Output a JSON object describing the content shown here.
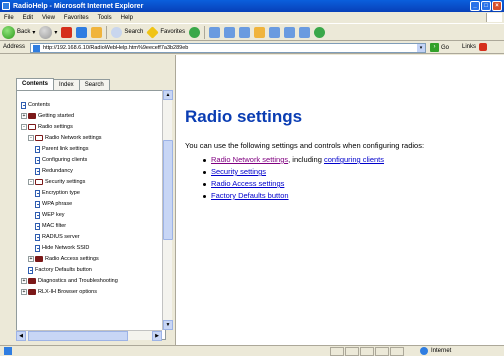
{
  "window": {
    "title": "RadioHelp - Microsoft Internet Explorer"
  },
  "menu": [
    "File",
    "Edit",
    "View",
    "Favorites",
    "Tools",
    "Help"
  ],
  "toolbar": {
    "back": "Back",
    "search": "Search",
    "favorites": "Favorites"
  },
  "address": {
    "label": "Address",
    "url": "http://192.168.6.10/RadioWebHelp.htm%9eeceff7a3b289eb",
    "go": "Go",
    "links": "Links"
  },
  "sidebar": {
    "tabs": [
      "Contents",
      "Index",
      "Search"
    ],
    "tree": [
      {
        "label": "Contents",
        "icon": "doc"
      },
      {
        "label": "Getting started",
        "icon": "book",
        "expander": "+"
      },
      {
        "label": "Radio settings",
        "icon": "book-open",
        "expander": "-"
      },
      {
        "label": "Radio Network settings",
        "icon": "book-open",
        "expander": "-"
      },
      {
        "label": "Parent link settings",
        "icon": "doc"
      },
      {
        "label": "Configuring clients",
        "icon": "doc"
      },
      {
        "label": "Redundancy",
        "icon": "doc"
      },
      {
        "label": "Security settings",
        "icon": "book-open",
        "expander": "-"
      },
      {
        "label": "Encryption type",
        "icon": "doc"
      },
      {
        "label": "WPA phrase",
        "icon": "doc"
      },
      {
        "label": "WEP key",
        "icon": "doc"
      },
      {
        "label": "MAC filter",
        "icon": "doc"
      },
      {
        "label": "RADIUS server",
        "icon": "doc"
      },
      {
        "label": "Hide Network SSID",
        "icon": "doc"
      },
      {
        "label": "Radio Access settings",
        "icon": "book",
        "expander": "+"
      },
      {
        "label": "Factory Defaults button",
        "icon": "doc"
      },
      {
        "label": "Diagnostics and Troubleshooting",
        "icon": "book",
        "expander": "+"
      },
      {
        "label": "RLX-IH Browser options",
        "icon": "book",
        "expander": "+"
      }
    ]
  },
  "content": {
    "heading": "Radio settings",
    "intro": "You can use the following settings and controls when configuring radios:",
    "links": {
      "radio_network": "Radio Network settings",
      "including": ", including ",
      "configuring_clients": "configuring clients",
      "security": "Security settings",
      "radio_access": "Radio Access settings",
      "factory": "Factory Defaults button"
    }
  },
  "status": {
    "zone": "Internet"
  }
}
